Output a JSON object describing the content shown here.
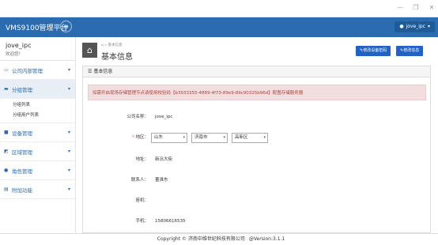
{
  "window": {
    "minimize": "—",
    "maximize": "❐",
    "close": "✕"
  },
  "header": {
    "app_title": "VMS9100管理平台",
    "menu_icon": "menu-icon",
    "user_label": "jove_ipc",
    "colors": {
      "bar": "#2b6cb0",
      "primary_button": "#2262c4"
    }
  },
  "sidebar": {
    "username": "jove_ipc",
    "welcome": "欢迎您！",
    "items": [
      {
        "label": "公司内部管理",
        "icon": "monitor-icon"
      },
      {
        "label": "分组管理",
        "icon": "folder-icon",
        "active": true,
        "children": [
          {
            "label": "分组列表"
          },
          {
            "label": "分组用户列表"
          }
        ]
      },
      {
        "label": "设备管理",
        "icon": "camera-icon"
      },
      {
        "label": "区域管理",
        "icon": "map-icon"
      },
      {
        "label": "角色管理",
        "icon": "user-icon"
      },
      {
        "label": "附加功能",
        "icon": "cog-icon"
      }
    ]
  },
  "page": {
    "breadcrumb": "基本信息",
    "title": "基本信息",
    "buttons": {
      "modify_code": "修改设备密码",
      "modify_info": "修改信息"
    },
    "panel_title": "基本信息",
    "alert": "如需开启现场存储管理节点请使用校验码【b3933355-4889-4f73-89e9-89c90325b96d】配置存储服务器",
    "form": {
      "company_label": "公司名称：",
      "company_value": "jove_ipc",
      "region_label": "地区：",
      "province": "山东",
      "city": "济南市",
      "district": "高新区",
      "address_label": "地址：",
      "address_value": "新泺大街",
      "contact_label": "联系人：",
      "contact_value": "董淮东",
      "fax_label": "座机：",
      "fax_value": "",
      "phone_label": "手机：",
      "phone_value": "15806616535"
    }
  },
  "footer": {
    "copyright": "Copyright © 济南中维世纪科技有限公司",
    "version": "@Version:3.1.1"
  }
}
